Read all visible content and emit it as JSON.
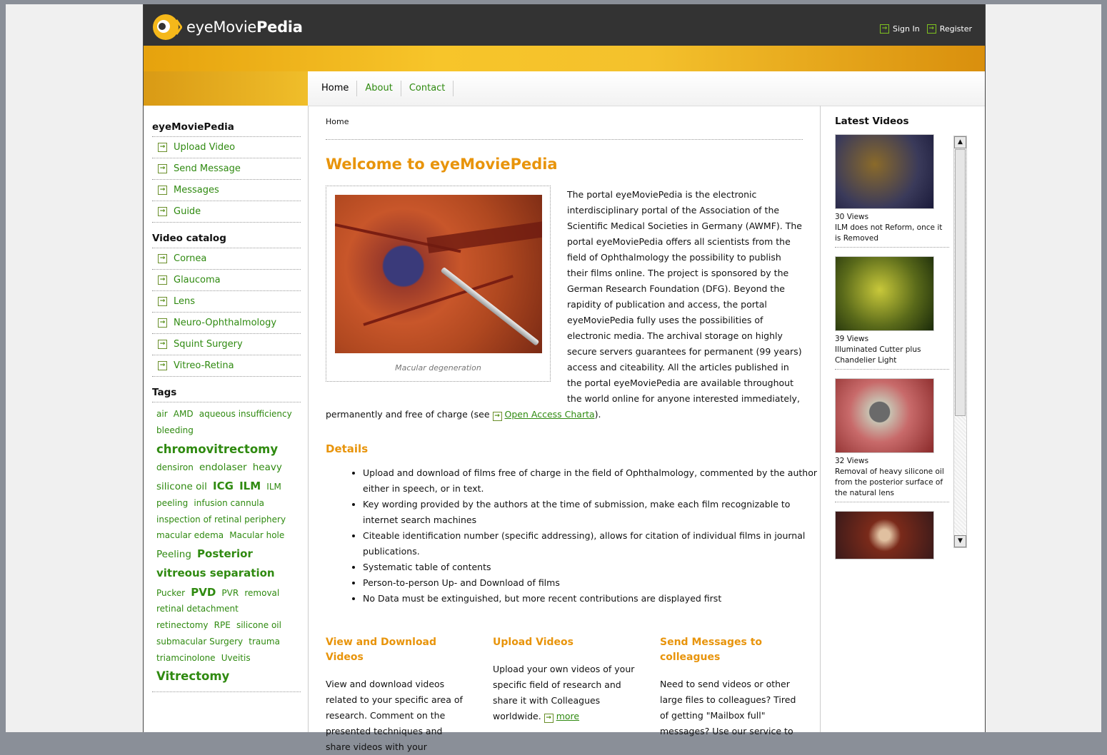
{
  "header": {
    "logo_text_light": "eye",
    "logo_text_mid": "Movie",
    "logo_text_bold": "Pedia",
    "sign_in": "Sign In",
    "register": "Register"
  },
  "nav": {
    "tabs": [
      "Home",
      "About",
      "Contact"
    ]
  },
  "sidebar": {
    "section1_title": "eyeMoviePedia",
    "section1_items": [
      "Upload Video",
      "Send Message",
      "Messages",
      "Guide"
    ],
    "section2_title": "Video catalog",
    "section2_items": [
      "Cornea",
      "Glaucoma",
      "Lens",
      "Neuro-Ophthalmology",
      "Squint Surgery",
      "Vitreo-Retina"
    ],
    "tags_title": "Tags",
    "tags": [
      {
        "label": "air",
        "size": 1
      },
      {
        "label": "AMD",
        "size": 1
      },
      {
        "label": "aqueous insufficiency",
        "size": 1
      },
      {
        "label": "bleeding",
        "size": 1
      },
      {
        "label": "chromovitrectomy",
        "size": 4
      },
      {
        "label": "densiron",
        "size": 1
      },
      {
        "label": "endolaser",
        "size": 2
      },
      {
        "label": "heavy silicone oil",
        "size": 2
      },
      {
        "label": "ICG",
        "size": 3
      },
      {
        "label": "ILM",
        "size": 3
      },
      {
        "label": "ILM peeling",
        "size": 1
      },
      {
        "label": "infusion cannula",
        "size": 1
      },
      {
        "label": "inspection of retinal periphery",
        "size": 1
      },
      {
        "label": "macular edema",
        "size": 1
      },
      {
        "label": "Macular hole",
        "size": 1
      },
      {
        "label": "Peeling",
        "size": 2
      },
      {
        "label": "Posterior vitreous separation",
        "size": 3
      },
      {
        "label": "Pucker",
        "size": 1
      },
      {
        "label": "PVD",
        "size": 3
      },
      {
        "label": "PVR",
        "size": 1
      },
      {
        "label": "removal",
        "size": 1
      },
      {
        "label": "retinal detachment",
        "size": 1
      },
      {
        "label": "retinectomy",
        "size": 1
      },
      {
        "label": "RPE",
        "size": 1
      },
      {
        "label": "silicone oil",
        "size": 1
      },
      {
        "label": "submacular Surgery",
        "size": 1
      },
      {
        "label": "trauma",
        "size": 1
      },
      {
        "label": "triamcinolone",
        "size": 1
      },
      {
        "label": "Uveitis",
        "size": 1
      },
      {
        "label": "Vitrectomy",
        "size": 4
      }
    ]
  },
  "main": {
    "breadcrumb": "Home",
    "title": "Welcome to eyeMoviePedia",
    "photo_caption": "Macular degeneration",
    "intro": "The portal eyeMoviePedia is the electronic interdisciplinary portal of the Association of the Scientific Medical Societies in Germany (AWMF). The portal eyeMoviePedia offers all scientists from the field of Ophthalmology the possibility to publish their films online. The project is sponsored by the German Research Foundation (DFG). Beyond the rapidity of publication and access, the portal eyeMoviePedia fully uses the possibilities of electronic media. The archival storage on highly secure servers guarantees for permanent (99 years) access and citeability. All the articles published in the portal eyeMoviePedia are available throughout the world online for anyone interested immediately,",
    "intro_tail_before": "permanently and free of charge (see",
    "open_access_link": "Open Access Charta",
    "intro_tail_after": ").",
    "details_title": "Details",
    "details": [
      "Upload and download of films free of charge in the field of Ophthalmology, commented by the author either in speech, or in text.",
      "Key wording provided by the authors at the time of submission, make each film recognizable to internet search machines",
      "Citeable identification number (specific addressing), allows for citation of individual films in journal publications.",
      "Systematic table of contents",
      "Person-to-person Up- and Download of films",
      "No Data must be extinguished, but more recent contributions are displayed first"
    ],
    "features": [
      {
        "title": "View and Download Videos",
        "text": "View and download videos related to your specific area of research. Comment on the presented techniques and share videos with your",
        "more": ""
      },
      {
        "title": "Upload Videos",
        "text": "Upload your own videos of your specific field of research and share it with Colleagues worldwide.",
        "more": "more"
      },
      {
        "title": "Send Messages to colleagues",
        "text": "Need to send videos or other large files to colleagues? Tired of getting \"Mailbox full\" messages? Use our service to",
        "more": ""
      }
    ]
  },
  "latest": {
    "title": "Latest Videos",
    "videos": [
      {
        "views": "30 Views",
        "title": "ILM does not Reform, once it is Removed"
      },
      {
        "views": "39 Views",
        "title": "Illuminated Cutter plus Chandelier Light"
      },
      {
        "views": "32 Views",
        "title": "Removal of heavy silicone oil from the posterior surface of the natural lens"
      },
      {
        "views": "",
        "title": ""
      }
    ]
  },
  "colors": {
    "accent": "#e8940b",
    "link": "#2f8a10",
    "topbar": "#333333"
  }
}
